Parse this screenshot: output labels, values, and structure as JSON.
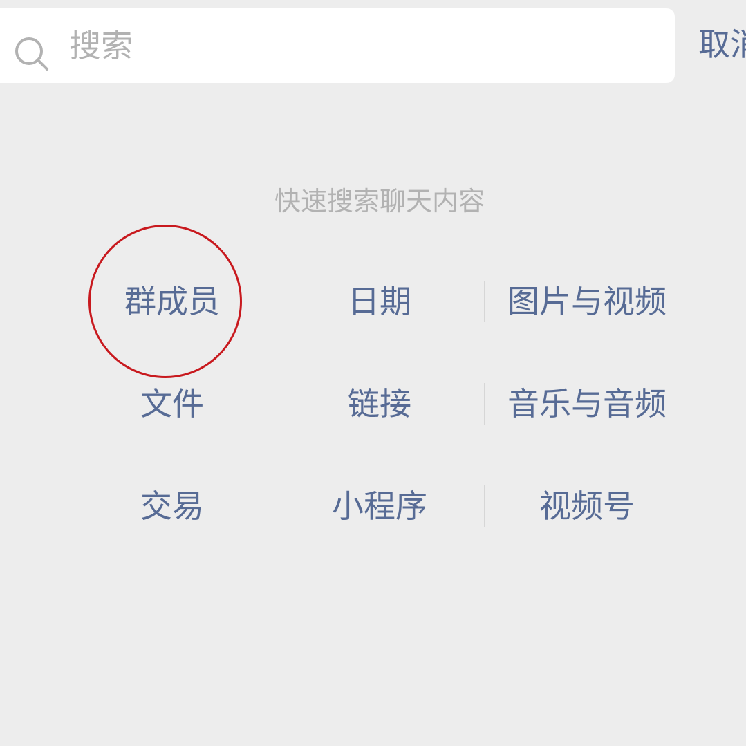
{
  "search": {
    "placeholder": "搜索",
    "value": "",
    "icon": "search-icon"
  },
  "cancel_label": "取消",
  "hint_text": "快速搜索聊天内容",
  "categories": [
    [
      "群成员",
      "日期",
      "图片与视频"
    ],
    [
      "文件",
      "链接",
      "音乐与音频"
    ],
    [
      "交易",
      "小程序",
      "视频号"
    ]
  ],
  "colors": {
    "background": "#ededed",
    "search_box": "#ffffff",
    "link": "#576b95",
    "hint": "#b2b2b2",
    "divider": "#d6d6d6",
    "highlight": "#c8191e"
  }
}
